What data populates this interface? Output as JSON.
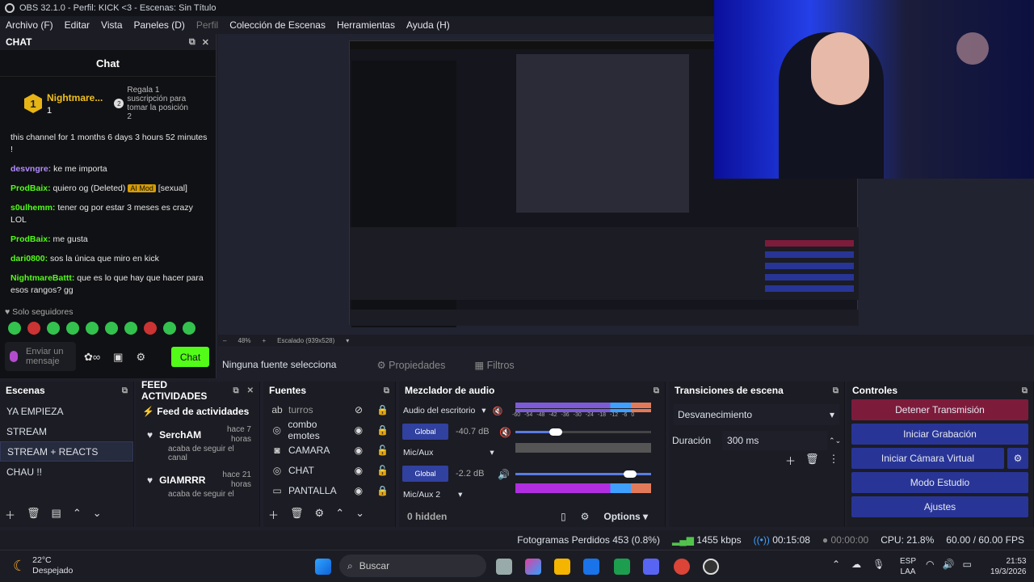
{
  "window": {
    "title": "OBS 32.1.0 - Perfil: KICK <3 - Escenas: Sin Título"
  },
  "menu": [
    "Archivo (F)",
    "Editar",
    "Vista",
    "Paneles (D)",
    "Perfil",
    "Colección de Escenas",
    "Herramientas",
    "Ayuda (H)"
  ],
  "chat": {
    "dock_title": "CHAT",
    "title": "Chat",
    "pinned": {
      "rank": "1",
      "name": "Nightmare...",
      "count": "1",
      "gift_rank": "2",
      "gift_text": "Regala 1 suscripción para tomar la posición 2"
    },
    "messages": [
      {
        "user": "",
        "text": "this channel for 1 months 6 days 3 hours 52 minutes !",
        "color": "#e6e6e6"
      },
      {
        "user": "desvngre:",
        "text": " ke me importa",
        "color": "#b48cff"
      },
      {
        "user": "ProdBaix:",
        "text": " quiero og (Deleted) ",
        "tag": "AI Mod",
        "tail": " [sexual]",
        "color": "#53fc18"
      },
      {
        "user": "s0ulhemm:",
        "text": " tener og por estar 3 meses es crazy LOL",
        "color": "#53fc18"
      },
      {
        "user": "ProdBaix:",
        "text": " me gusta",
        "color": "#53fc18"
      },
      {
        "user": "dari0800:",
        "text": " sos la única que miro en kick",
        "color": "#53fc18"
      },
      {
        "user": "NightmareBattt:",
        "text": " que es lo que hay que hacer para esos rangos? gg",
        "color": "#53fc18"
      }
    ],
    "followers": "Solo seguidores",
    "input_placeholder": "Enviar un mensaje",
    "send_label": "Chat"
  },
  "preview": {
    "zoom": "48%",
    "scaling": "Escalado (939x528)"
  },
  "source_bar": {
    "no_source": "Ninguna fuente selecciona",
    "properties": "Propiedades",
    "filters": "Filtros"
  },
  "scenes": {
    "title": "Escenas",
    "items": [
      "YA EMPIEZA",
      "STREAM",
      "STREAM + REACTS",
      "CHAU !!"
    ],
    "selected": 2
  },
  "feed": {
    "title": "FEED ACTIVIDADES",
    "subtitle": "Feed de actividades",
    "items": [
      {
        "name": "SerchAM",
        "time": "hace 7 horas",
        "text": "acaba de seguir el canal"
      },
      {
        "name": "GIAMRRR",
        "time": "hace 21 horas",
        "text": "acaba de seguir el"
      }
    ]
  },
  "sources": {
    "title": "Fuentes",
    "items": [
      "turros",
      "combo emotes",
      "CAMARA",
      "CHAT",
      "PANTALLA"
    ]
  },
  "mixer": {
    "title": "Mezclador de audio",
    "channels": [
      {
        "name": "Audio del escritorio",
        "db": "-40.7 dB",
        "mode": "Global"
      },
      {
        "name": "Mic/Aux",
        "db": "-2.2 dB",
        "mode": "Global"
      },
      {
        "name": "Mic/Aux 2"
      }
    ],
    "scale": [
      "-60",
      "-54",
      "-48",
      "-42",
      "-36",
      "-30",
      "-24",
      "-18",
      "-12",
      "-6",
      "0"
    ],
    "hidden": "0 hidden",
    "options": "Options"
  },
  "transitions": {
    "title": "Transiciones de escena",
    "type": "Desvanecimiento",
    "duration_label": "Duración",
    "duration": "300 ms"
  },
  "controls": {
    "title": "Controles",
    "stop_stream": "Detener Transmisión",
    "start_rec": "Iniciar Grabación",
    "virtual_cam": "Iniciar Cámara Virtual",
    "studio": "Modo Estudio",
    "settings": "Ajustes"
  },
  "status": {
    "dropped": "Fotogramas Perdidos 453 (0.8%)",
    "bitrate": "1455 kbps",
    "stream_time": "00:15:08",
    "rec_time": "00:00:00",
    "cpu": "CPU: 21.8%",
    "fps": "60.00 / 60.00 FPS"
  },
  "taskbar": {
    "temp": "22°C",
    "weather": "Despejado",
    "search": "Buscar",
    "lang": "ESP",
    "layout": "LAA",
    "time": "21:53",
    "date": "19/3/2026"
  }
}
